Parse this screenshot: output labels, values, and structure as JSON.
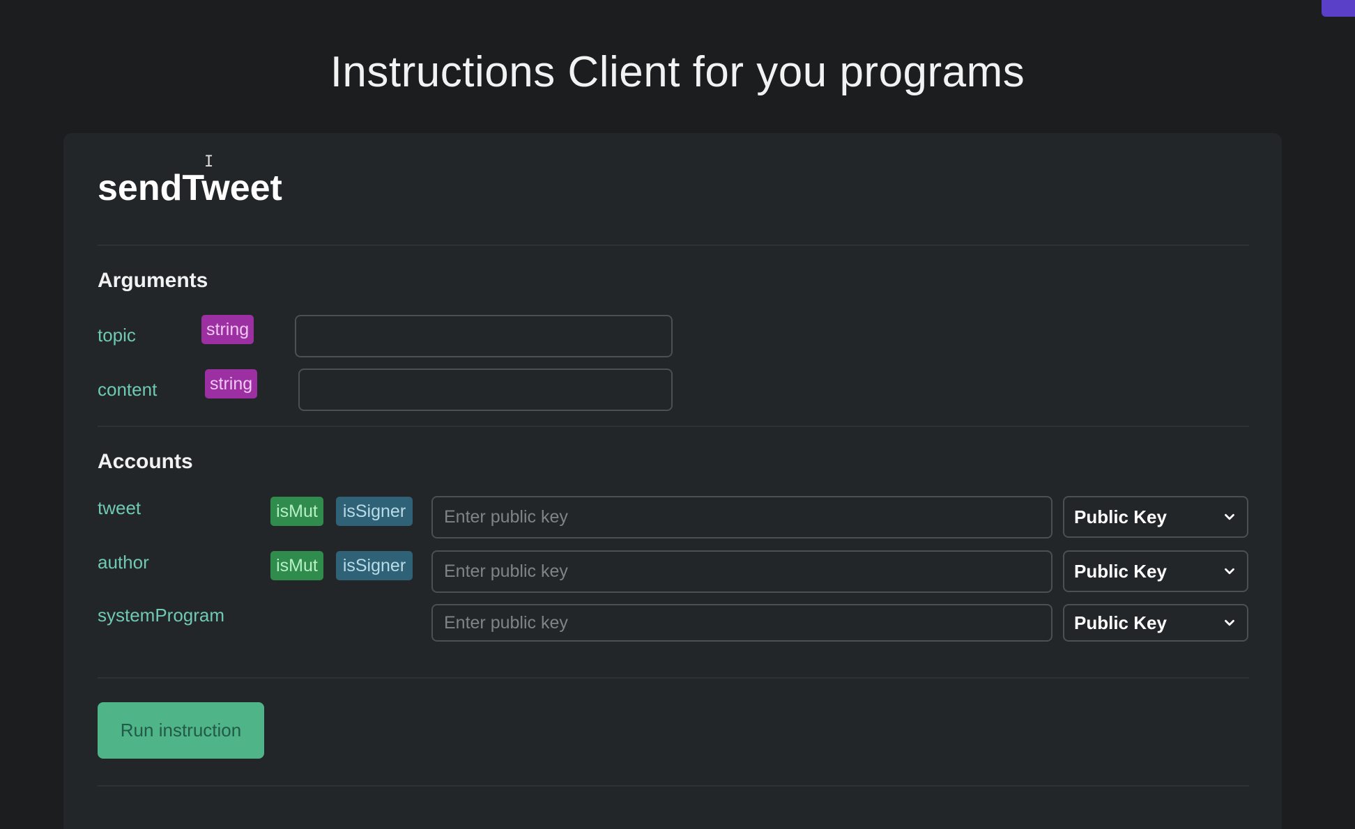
{
  "header": {
    "title": "Instructions Client for you programs"
  },
  "instruction": {
    "name": "sendTweet",
    "arguments_heading": "Arguments",
    "arguments": [
      {
        "label": "topic",
        "type": "string",
        "value": ""
      },
      {
        "label": "content",
        "type": "string",
        "value": ""
      }
    ],
    "accounts_heading": "Accounts",
    "accounts": [
      {
        "label": "tweet",
        "tags": [
          "isMut",
          "isSigner"
        ],
        "placeholder": "Enter public key",
        "select_value": "Public Key"
      },
      {
        "label": "author",
        "tags": [
          "isMut",
          "isSigner"
        ],
        "placeholder": "Enter public key",
        "select_value": "Public Key"
      },
      {
        "label": "systemProgram",
        "tags": [],
        "placeholder": "Enter public key",
        "select_value": "Public Key"
      }
    ],
    "run_button_label": "Run instruction"
  },
  "colors": {
    "page_background": "#1b1d1e",
    "card_background": "#222628",
    "label_accent": "#6fc9b4",
    "string_tag": "#9c2fa2",
    "mut_tag": "#2f8c4c",
    "signer_tag": "#2f6277",
    "run_button": "#4fb589",
    "corner_badge": "#5a3fc9"
  },
  "icons": {
    "select_arrow": "chevron-down-icon",
    "text_cursor": "text-cursor-icon"
  }
}
